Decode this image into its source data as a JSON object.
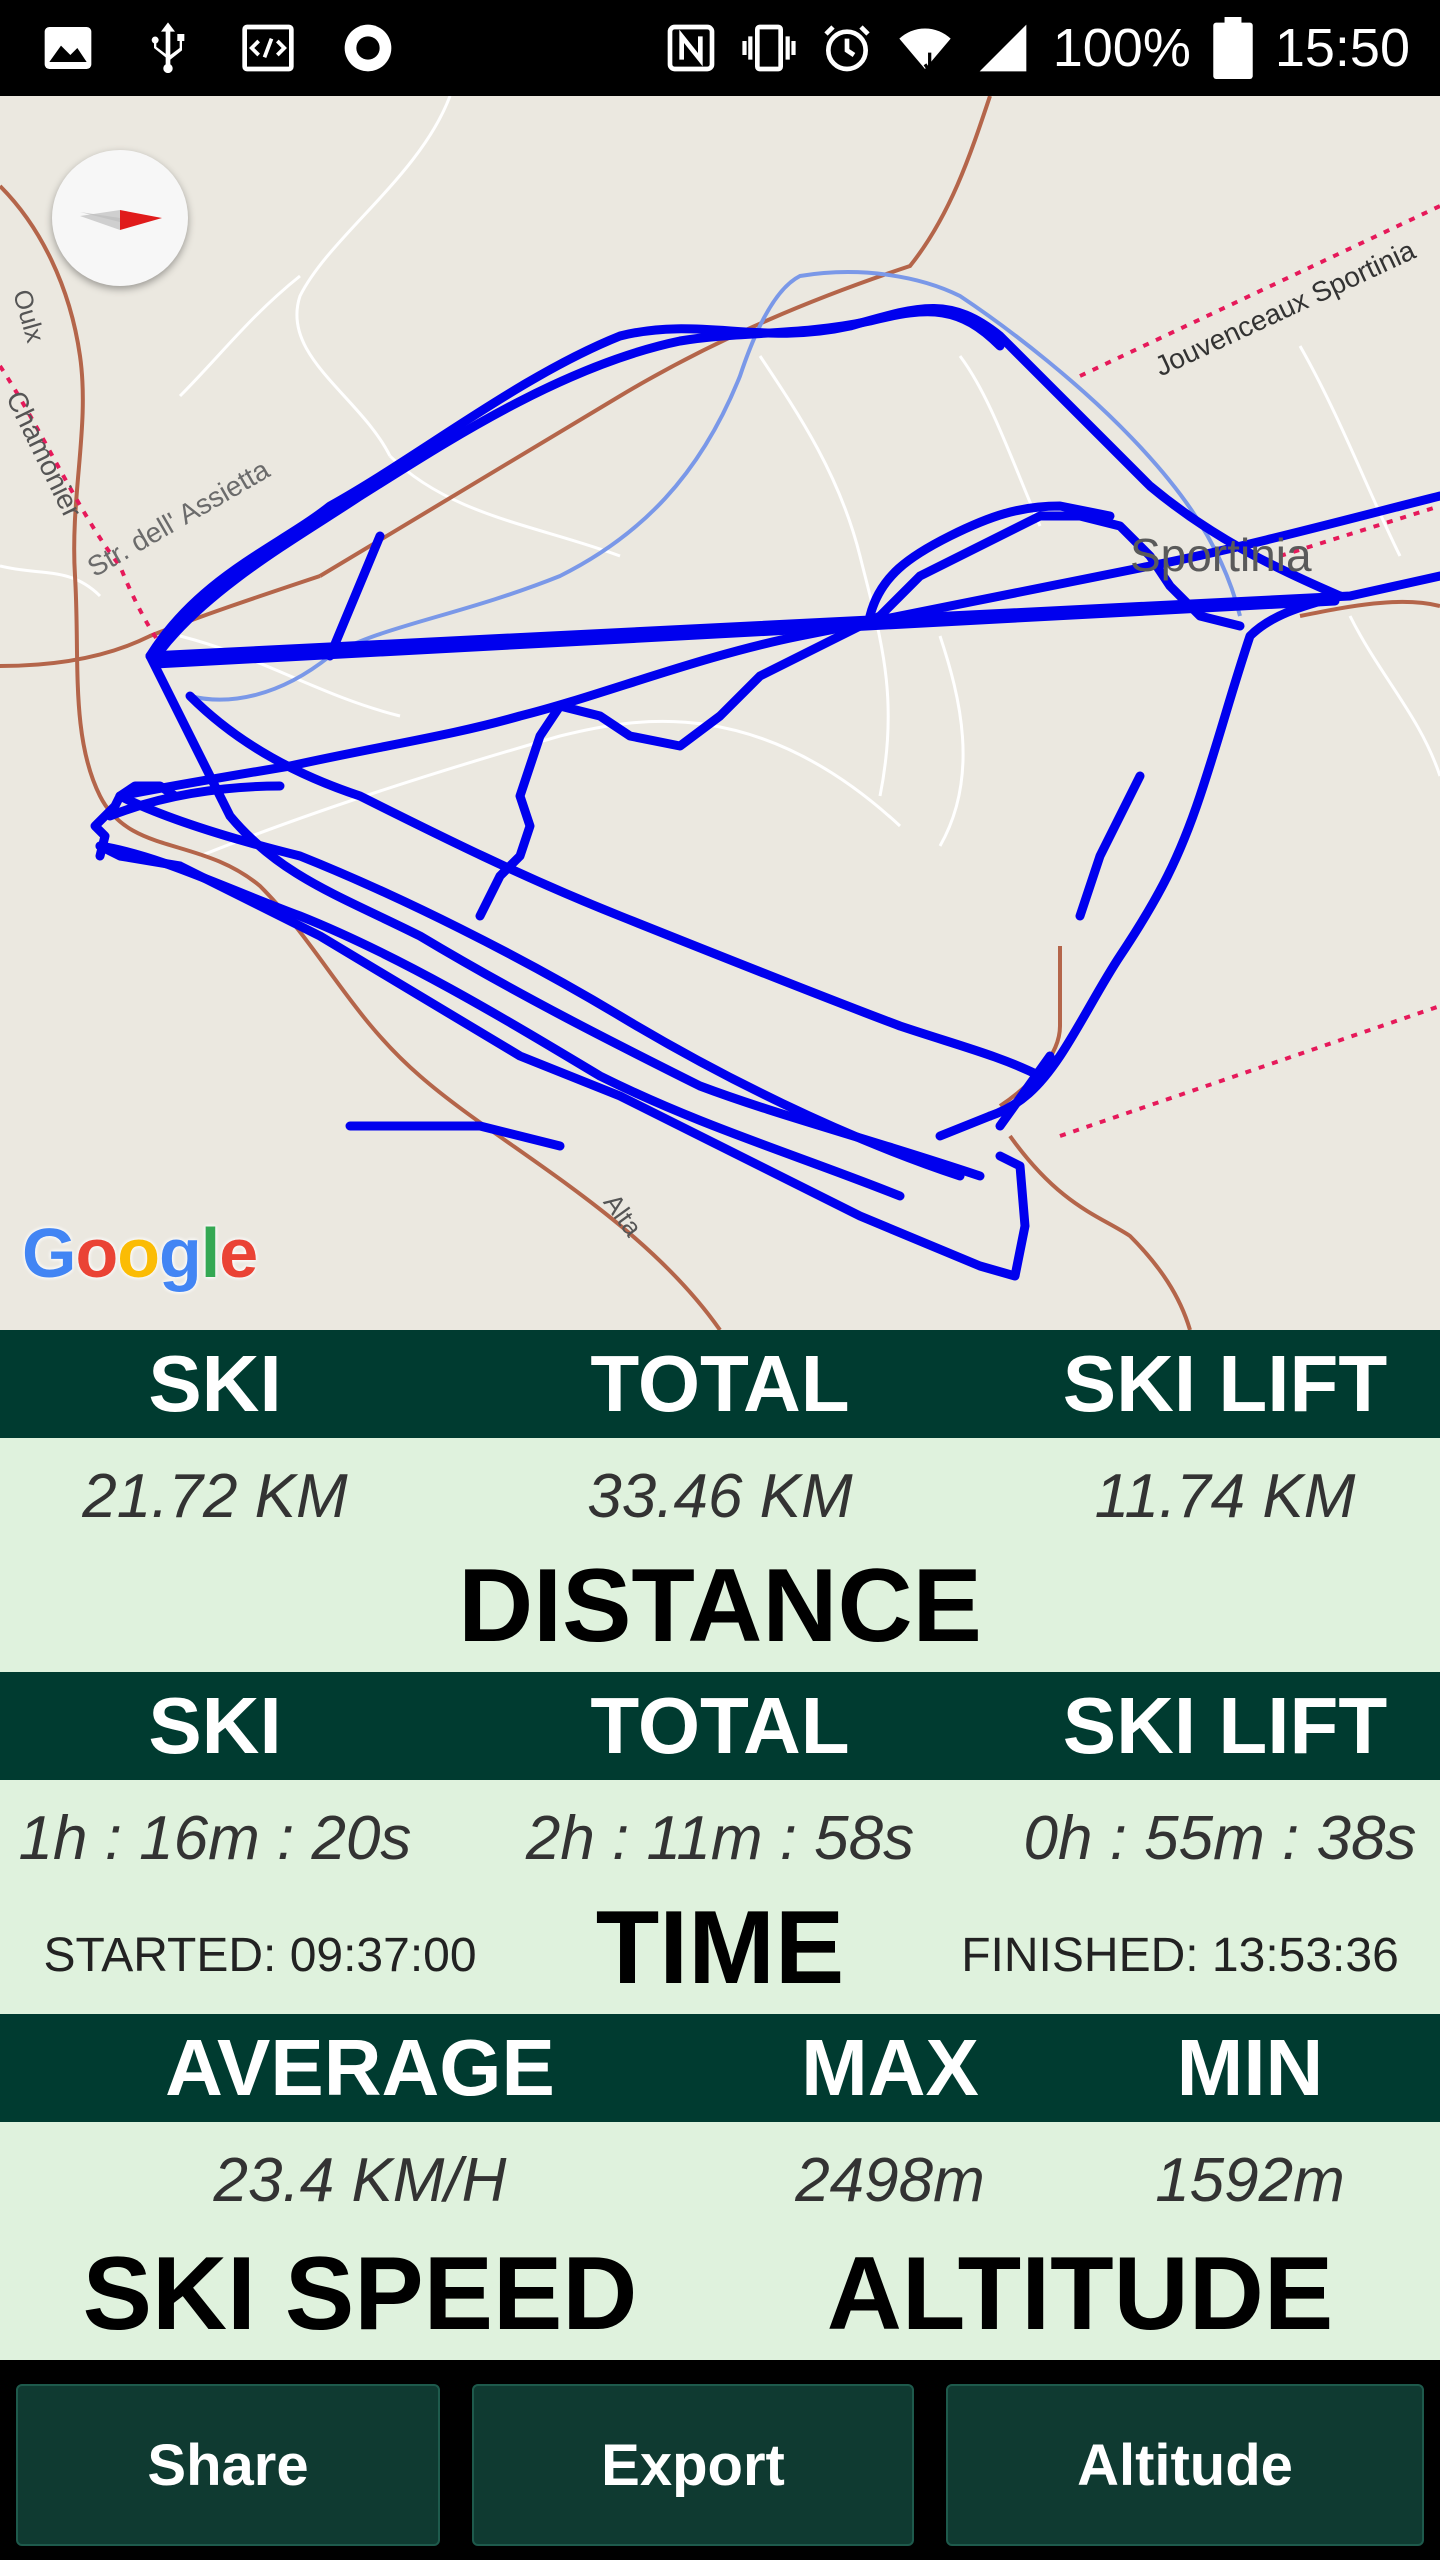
{
  "status_bar": {
    "battery_percent": "100%",
    "clock": "15:50",
    "left_icons": [
      "image-icon",
      "usb-icon",
      "code-icon",
      "record-icon"
    ],
    "right_icons": [
      "nfc-icon",
      "vibrate-icon",
      "alarm-icon",
      "wifi-icon",
      "signal-icon",
      "battery-icon"
    ]
  },
  "map": {
    "labels": {
      "oulx": "Oulx",
      "chamonier": "Chamonier",
      "str_assietta": "Str. dell' Assietta",
      "jouvenceaux": "Jouvenceaux Sportinia",
      "sportinia": "Sportinia",
      "alta": "Alta"
    },
    "attribution": "Google",
    "track_color": "#0000ee"
  },
  "distance": {
    "headers": {
      "ski": "SKI",
      "total": "TOTAL",
      "ski_lift": "SKI LIFT"
    },
    "values": {
      "ski": "21.72 KM",
      "total": "33.46 KM",
      "ski_lift": "11.74 KM"
    },
    "label": "DISTANCE"
  },
  "time": {
    "headers": {
      "ski": "SKI",
      "total": "TOTAL",
      "ski_lift": "SKI LIFT"
    },
    "values": {
      "ski": "1h : 16m : 20s",
      "total": "2h : 11m : 58s",
      "ski_lift": "0h : 55m : 38s"
    },
    "label": "TIME",
    "started": "STARTED: 09:37:00",
    "finished": "FINISHED: 13:53:36"
  },
  "speed_altitude": {
    "headers": {
      "average": "AVERAGE",
      "max": "MAX",
      "min": "MIN"
    },
    "values": {
      "average": "23.4 KM/H",
      "max": "2498m",
      "min": "1592m"
    },
    "speed_label": "SKI SPEED",
    "altitude_label": "ALTITUDE"
  },
  "buttons": {
    "share": "Share",
    "export": "Export",
    "altitude": "Altitude"
  },
  "colors": {
    "header_bg": "#003b30",
    "value_bg": "#dff2dd",
    "button_bg": "#0f3a31",
    "map_bg": "#ebe8e0"
  }
}
